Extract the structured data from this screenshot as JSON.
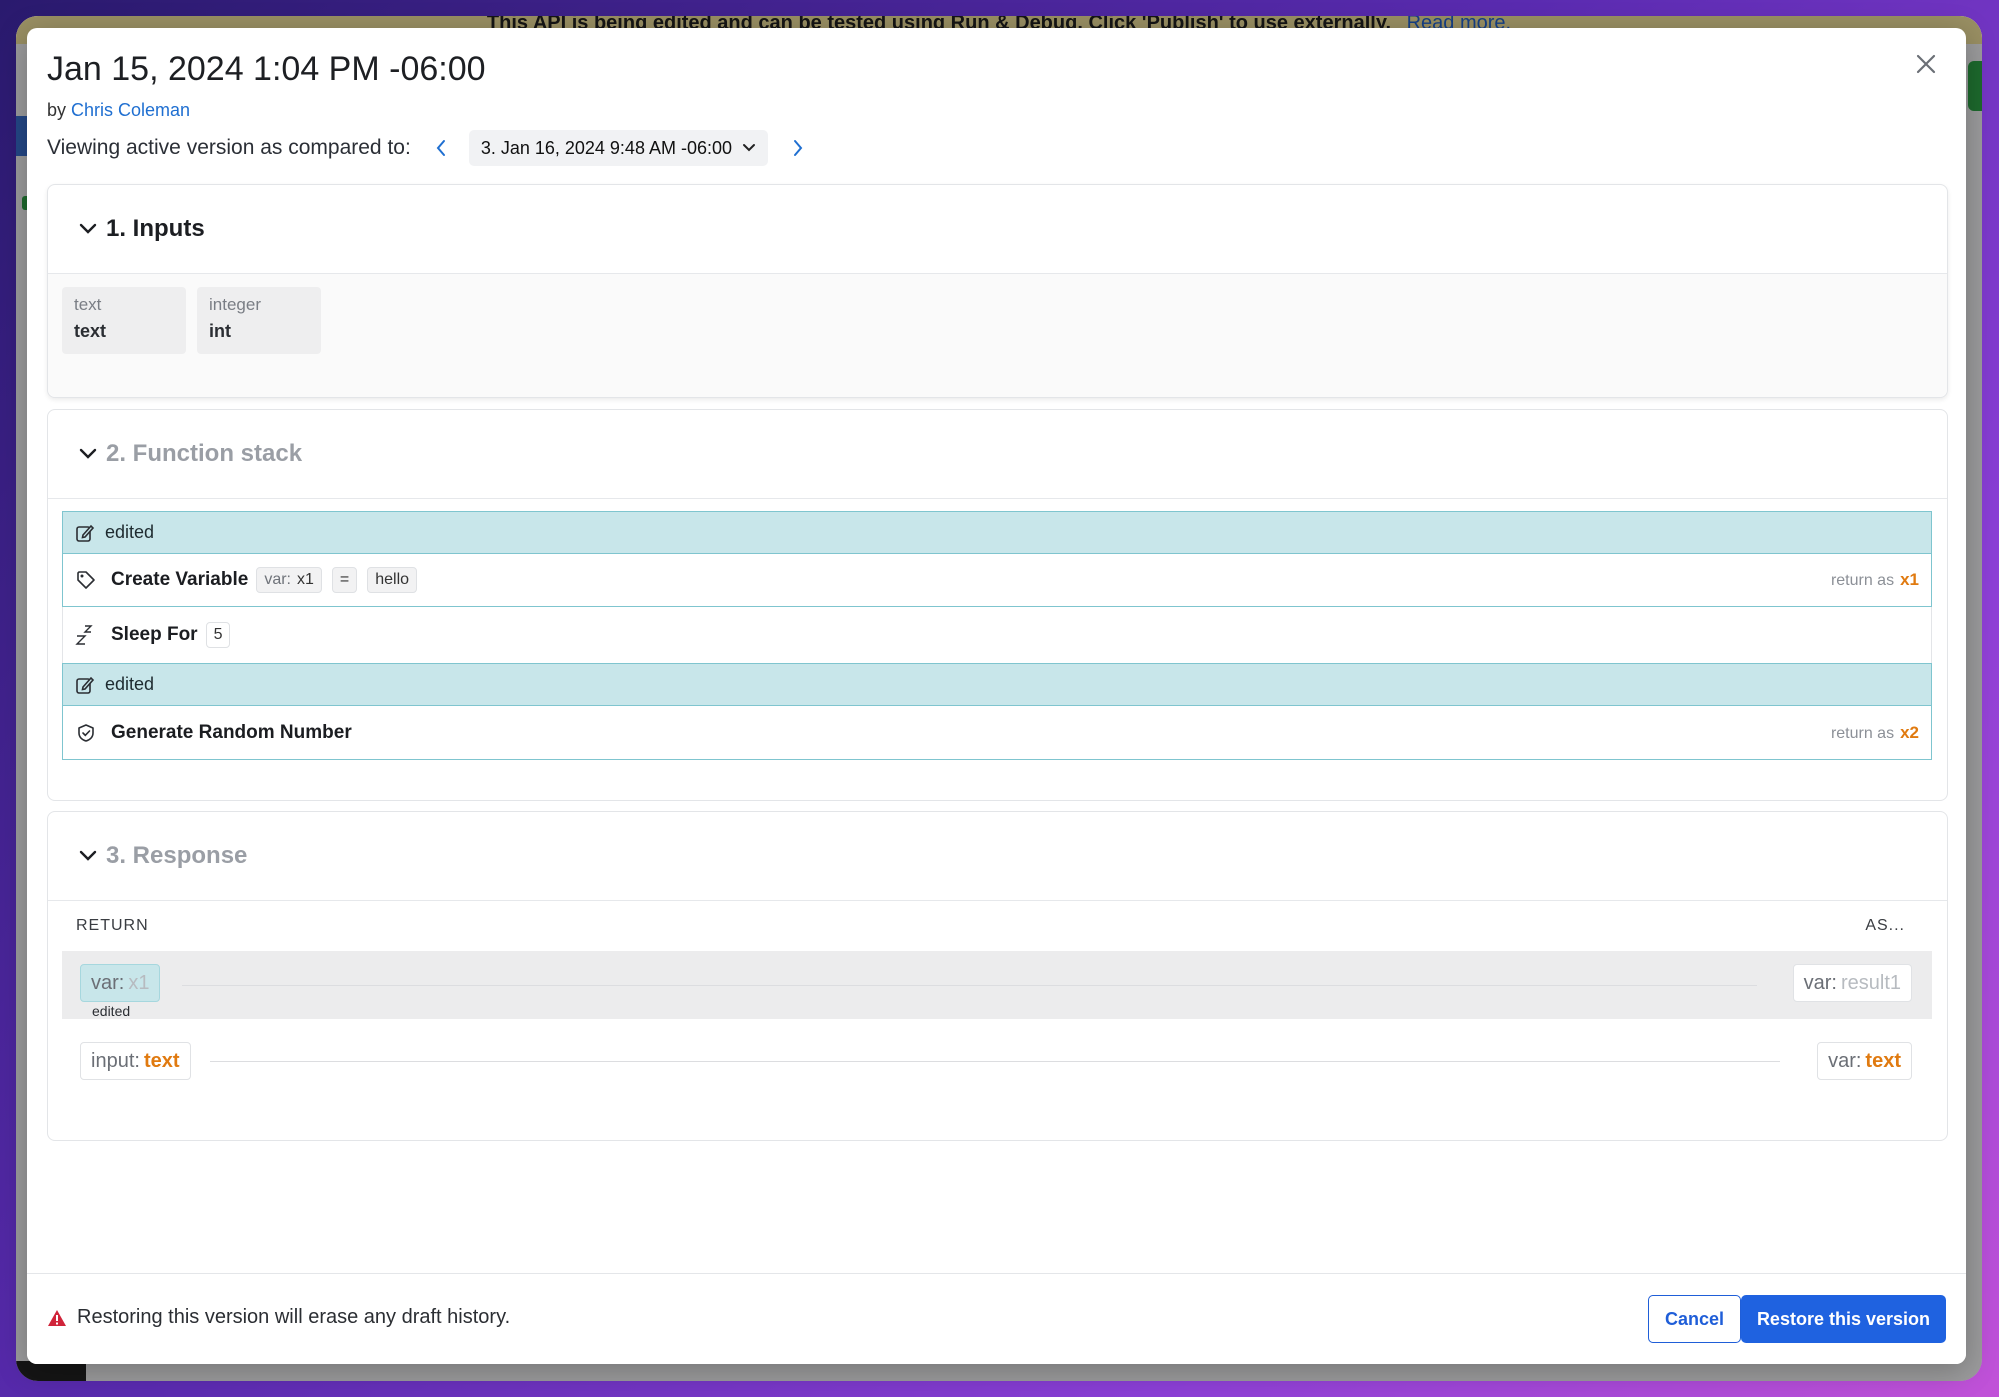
{
  "background": {
    "banner_text": "This API is being edited and can be tested using Run & Debug. Click 'Publish' to use externally.",
    "banner_link": "Read more."
  },
  "modal": {
    "title": "Jan 15, 2024 1:04 PM -06:00",
    "by_prefix": "by",
    "author": "Chris Coleman",
    "compare_label": "Viewing active version as compared to:",
    "compare_version": "3. Jan 16, 2024 9:48 AM -06:00",
    "icons": {
      "close": "close-icon",
      "prev": "chevron-left-icon",
      "next": "chevron-right-icon",
      "dropdown": "chevron-down-icon"
    }
  },
  "inputs_section": {
    "title": "1. Inputs",
    "items": [
      {
        "type": "text",
        "name": "text"
      },
      {
        "type": "integer",
        "name": "int"
      }
    ]
  },
  "function_section": {
    "title": "2. Function stack",
    "edited_label": "edited",
    "steps": [
      {
        "name": "Create Variable",
        "icon": "tag-icon",
        "var_label": "var:",
        "var_name": "x1",
        "operator": "=",
        "value": "hello",
        "return_label": "return as",
        "return_var": "x1",
        "edited": true
      },
      {
        "name": "Sleep For",
        "icon": "sleep-icon",
        "arg": "5",
        "edited": false
      },
      {
        "name": "Generate Random Number",
        "icon": "shield-check-icon",
        "return_label": "return as",
        "return_var": "x2",
        "edited": true
      }
    ]
  },
  "response_section": {
    "title": "3. Response",
    "col_return": "RETURN",
    "col_as": "AS...",
    "rows": [
      {
        "left_label": "var:",
        "left_value": "x1",
        "right_label": "var:",
        "right_value": "result1",
        "edited": "edited"
      },
      {
        "left_label": "input:",
        "left_value": "text",
        "right_label": "var:",
        "right_value": "text"
      }
    ]
  },
  "footer": {
    "warning": "Restoring this version will erase any draft history.",
    "cancel": "Cancel",
    "restore": "Restore this version"
  },
  "colors": {
    "accent_blue": "#1f62e0",
    "edited_teal": "#c8e6ea",
    "var_orange": "#e07a10",
    "warning_red": "#d0243a"
  }
}
